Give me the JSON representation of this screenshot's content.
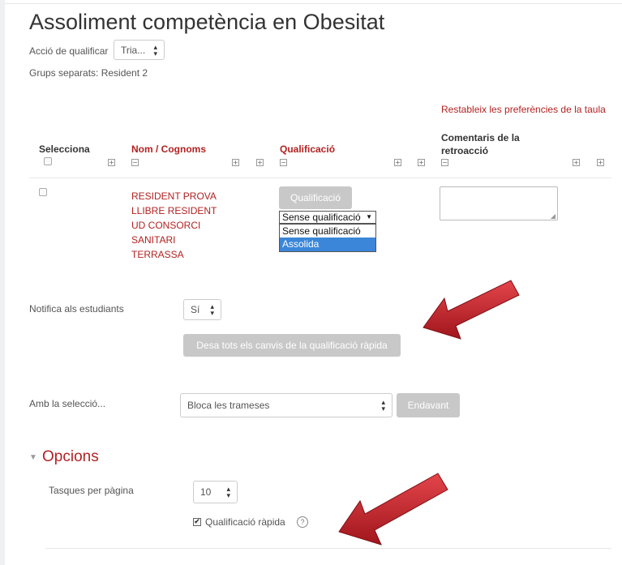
{
  "page": {
    "title": "Assoliment competència en Obesitat"
  },
  "grading_action": {
    "label": "Acció de qualificar",
    "value": "Tria..."
  },
  "groups": {
    "text": "Grups separats: Resident 2"
  },
  "reset_link": "Restableix les preferències de la taula",
  "table": {
    "headers": {
      "select": "Selecciona",
      "name": "Nom / Cognoms",
      "grade": "Qualificació",
      "feedback": "Comentaris de la retroacció"
    },
    "rows": [
      {
        "name": "RESIDENT PROVA LLIBRE RESIDENT UD CONSORCI SANITARI TERRASSA",
        "grade_button": "Qualificació",
        "grade_select": "Sense qualificació",
        "dropdown_options": [
          "Sense qualificació",
          "Assolida"
        ]
      }
    ]
  },
  "notify": {
    "label": "Notifica als estudiants",
    "value": "Sí"
  },
  "save_button": "Desa tots els canvis de la qualificació ràpida",
  "with_selection": {
    "label": "Amb la selecció...",
    "value": "Bloca les trameses",
    "go_button": "Endavant"
  },
  "options": {
    "title": "Opcions",
    "per_page_label": "Tasques per pàgina",
    "per_page_value": "10",
    "quick_grading_label": "Qualificació ràpida",
    "quick_grading_checked": true
  },
  "colors": {
    "link": "#b22222",
    "arrow": "#c0262c",
    "selected_option": "#3b86d8"
  }
}
